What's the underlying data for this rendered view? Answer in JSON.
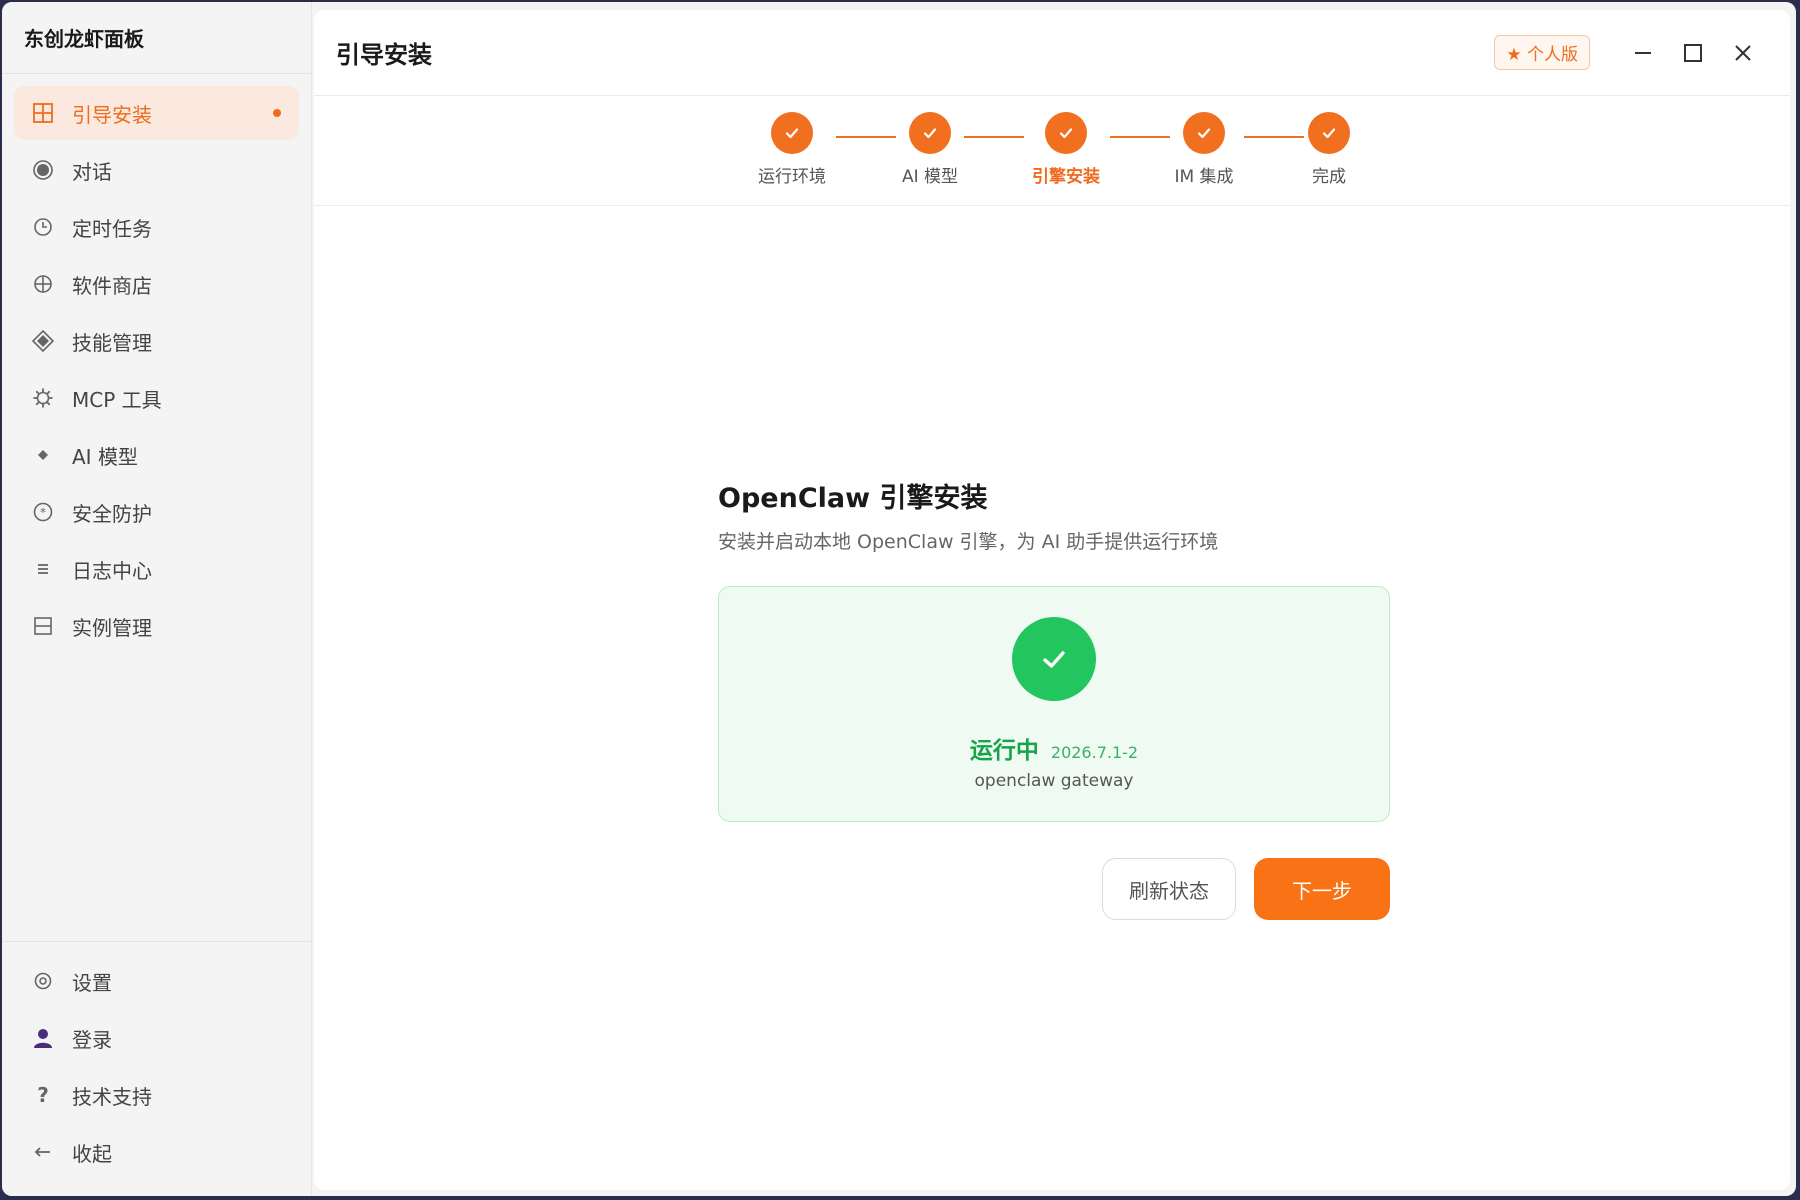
{
  "app": {
    "title": "东创龙虾面板"
  },
  "sidebar": {
    "items": [
      {
        "label": "引导安装",
        "icon": "grid-icon",
        "active": true
      },
      {
        "label": "对话",
        "icon": "radio-circle-icon"
      },
      {
        "label": "定时任务",
        "icon": "clock-icon"
      },
      {
        "label": "软件商店",
        "icon": "globe-icon"
      },
      {
        "label": "技能管理",
        "icon": "diamond-icon"
      },
      {
        "label": "MCP 工具",
        "icon": "cog-icon"
      },
      {
        "label": "AI 模型",
        "icon": "small-diamond-icon"
      },
      {
        "label": "安全防护",
        "icon": "shield-circle-icon"
      },
      {
        "label": "日志中心",
        "icon": "list-icon"
      },
      {
        "label": "实例管理",
        "icon": "panel-icon"
      }
    ],
    "bottom": [
      {
        "label": "设置",
        "icon": "settings-icon"
      },
      {
        "label": "登录",
        "icon": "user-icon"
      },
      {
        "label": "技术支持",
        "icon": "question-icon"
      },
      {
        "label": "收起",
        "icon": "arrow-left-icon"
      }
    ]
  },
  "header": {
    "title": "引导安装",
    "edition": "★ 个人版"
  },
  "stepper": {
    "steps": [
      {
        "label": "运行环境",
        "done": true
      },
      {
        "label": "AI 模型",
        "done": true
      },
      {
        "label": "引擎安装",
        "done": true,
        "current": true
      },
      {
        "label": "IM 集成",
        "done": true
      },
      {
        "label": "完成",
        "done": true
      }
    ]
  },
  "main": {
    "title": "OpenClaw 引擎安装",
    "subtitle": "安装并启动本地 OpenClaw 引擎，为 AI 助手提供运行环境",
    "status": {
      "text": "运行中",
      "version": "2026.7.1-2",
      "service": "openclaw gateway"
    },
    "buttons": {
      "refresh": "刷新状态",
      "next": "下一步"
    }
  },
  "colors": {
    "accent": "#f97316",
    "success": "#22c55e",
    "active_bg": "#fbe9df"
  }
}
